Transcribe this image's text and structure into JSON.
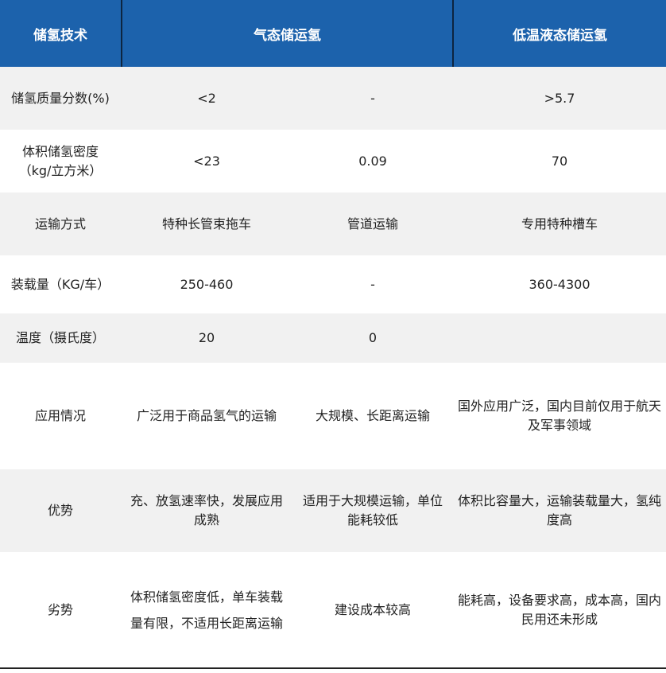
{
  "header": [
    "储氢技术",
    "气态储运氢",
    "",
    "低温液态储运氢"
  ],
  "rows": [
    [
      "储氢质量分数(%)",
      "<2",
      "-",
      ">5.7"
    ],
    [
      "体积储氢密度（kg/立方米）",
      "<23",
      "0.09",
      "70"
    ],
    [
      "运输方式",
      "特种长管束拖车",
      "管道运输",
      "专用特种槽车"
    ],
    [
      "装载量（KG/车）",
      "250-460",
      "-",
      "360-4300"
    ],
    [
      "温度（摄氏度）",
      "20",
      "0",
      ""
    ],
    [
      "应用情况",
      "广泛用于商品氢气的运输",
      "大规模、长距离运输",
      "国外应用广泛，国内目前仅用于航天及军事领域"
    ],
    [
      "优势",
      "充、放氢速率快，发展应用成熟",
      "适用于大规模运输，单位能耗较低",
      "体积比容量大，运输装载量大，氢纯度高"
    ],
    [
      "劣势",
      "体积储氢密度低，单车装载量有限，不适用长距离运输",
      "建设成本较高",
      "能耗高，设备要求高，成本高，国内民用还未形成"
    ]
  ],
  "colors": {
    "header_bg": "#1c62ac",
    "header_text": "#ffffff",
    "shade_row": "#f1f1f1",
    "divider": "#0d2540"
  }
}
